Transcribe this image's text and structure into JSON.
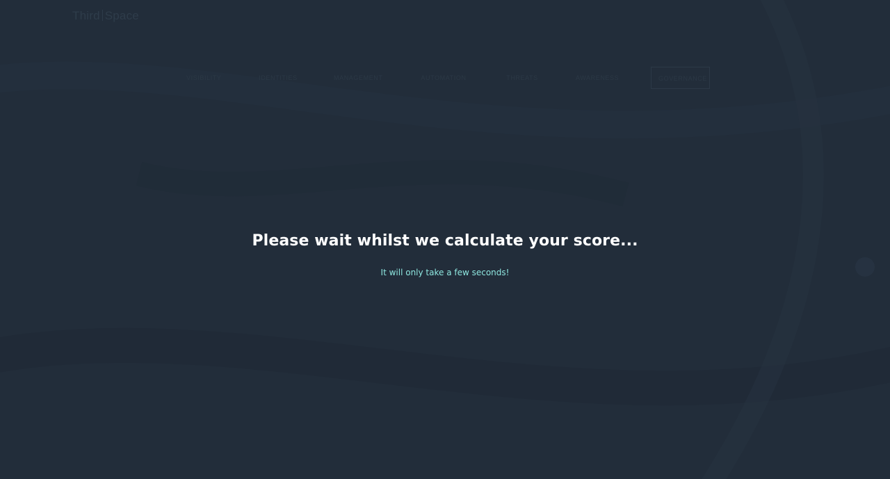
{
  "header": {
    "logo_left": "Third",
    "logo_right": "Space"
  },
  "nav": {
    "items": [
      {
        "label": "Visibility"
      },
      {
        "label": "Identities"
      },
      {
        "label": "Management"
      },
      {
        "label": "Automation"
      },
      {
        "label": "Threats"
      },
      {
        "label": "Awareness"
      },
      {
        "label": "Governance"
      }
    ]
  },
  "overlay": {
    "title": "Please wait whilst we calculate your score...",
    "subtitle": "It will only take a few seconds!"
  },
  "colors": {
    "background": "#222d3a",
    "title": "#ffffff",
    "subtitle_accent": "#8ee6df"
  }
}
